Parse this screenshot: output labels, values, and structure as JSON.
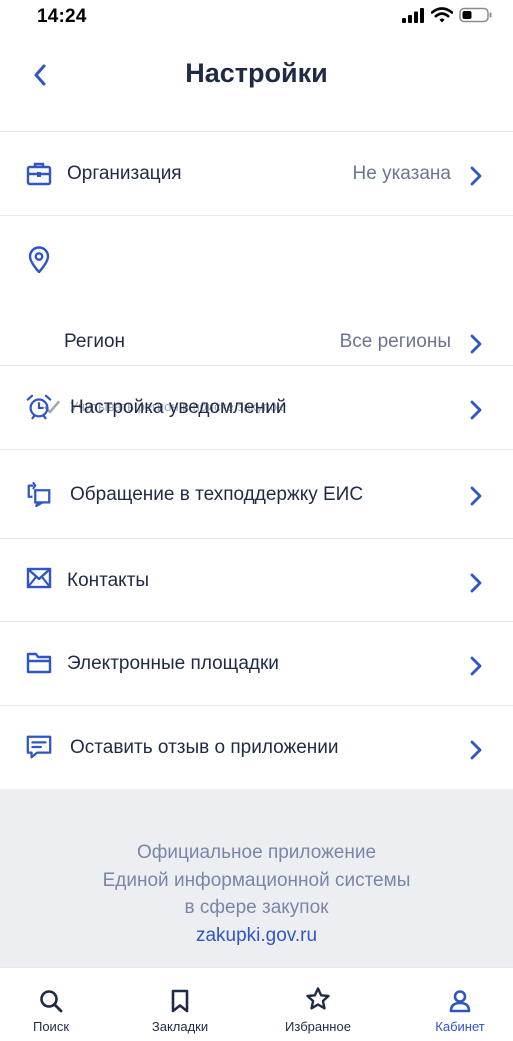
{
  "status_bar": {
    "time": "14:24"
  },
  "header": {
    "title": "Настройки"
  },
  "settings": {
    "organization": {
      "label": "Организация",
      "value": "Не указана"
    },
    "region": {
      "label": "Регион",
      "value": "Все регионы",
      "hint": "Учитывать регион в поиске закупок"
    },
    "notifications": {
      "label": "Настройка уведомлений"
    },
    "support": {
      "label": "Обращение в техподдержку ЕИС"
    },
    "contacts": {
      "label": "Контакты"
    },
    "platforms": {
      "label": "Электронные площадки"
    },
    "feedback": {
      "label": "Оставить отзыв о приложении"
    }
  },
  "footer": {
    "line1": "Официальное приложение",
    "line2": "Единой информационной системы",
    "line3": "в сфере закупок",
    "link": "zakupki.gov.ru"
  },
  "tabs": {
    "search": "Поиск",
    "bookmarks": "Закладки",
    "favorites": "Избранное",
    "cabinet": "Кабинет"
  },
  "colors": {
    "accent": "#2f55c7",
    "text": "#1f2a44",
    "secondary_text": "#6b7590",
    "footer_bg": "#eceef2"
  },
  "icons": {
    "organization": "briefcase-icon",
    "region": "map-pin-icon",
    "notifications": "alarm-clock-icon",
    "support": "chat-bubbles-icon",
    "contacts": "envelope-icon",
    "platforms": "folder-icon",
    "feedback": "message-icon",
    "search": "search-icon",
    "bookmarks": "bookmark-icon",
    "favorites": "star-icon",
    "cabinet": "user-icon"
  }
}
